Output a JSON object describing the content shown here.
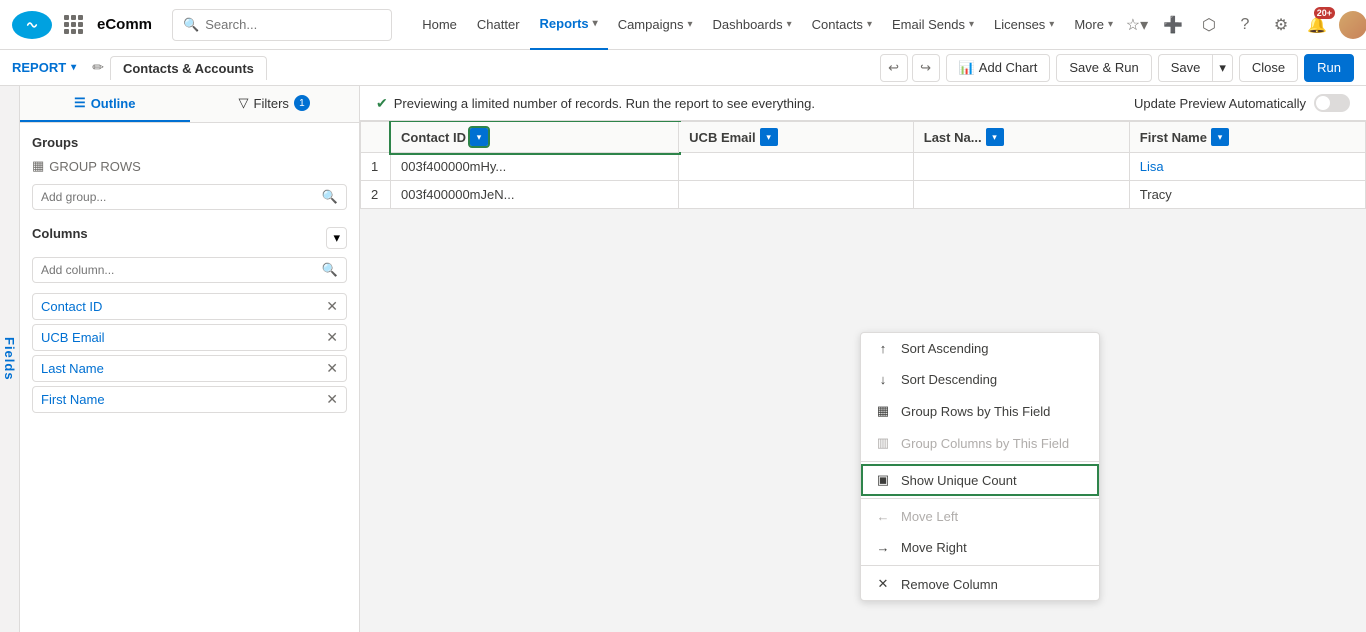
{
  "app": {
    "name": "eComm"
  },
  "topnav": {
    "search_placeholder": "Search...",
    "links": [
      {
        "label": "Home",
        "active": false,
        "has_dropdown": false
      },
      {
        "label": "Chatter",
        "active": false,
        "has_dropdown": false
      },
      {
        "label": "Reports",
        "active": true,
        "has_dropdown": true
      },
      {
        "label": "Campaigns",
        "active": false,
        "has_dropdown": true
      },
      {
        "label": "Dashboards",
        "active": false,
        "has_dropdown": true
      },
      {
        "label": "Contacts",
        "active": false,
        "has_dropdown": true
      },
      {
        "label": "Email Sends",
        "active": false,
        "has_dropdown": true
      },
      {
        "label": "Licenses",
        "active": false,
        "has_dropdown": true
      },
      {
        "label": "More",
        "active": false,
        "has_dropdown": true
      }
    ],
    "notification_count": "20+"
  },
  "secondarynav": {
    "report_badge_label": "REPORT",
    "report_name": "Contacts & Accounts",
    "toolbar": {
      "undo_title": "Undo",
      "redo_title": "Redo",
      "add_chart_label": "Add Chart",
      "save_run_label": "Save & Run",
      "save_label": "Save",
      "close_label": "Close",
      "run_label": "Run"
    }
  },
  "left_panel": {
    "outline_tab": "Outline",
    "filters_tab": "Filters",
    "filters_count": "1",
    "groups_label": "Groups",
    "group_rows_label": "GROUP ROWS",
    "add_group_placeholder": "Add group...",
    "columns_label": "Columns",
    "add_column_placeholder": "Add column...",
    "columns": [
      {
        "name": "Contact ID"
      },
      {
        "name": "UCB Email"
      },
      {
        "name": "Last Name"
      },
      {
        "name": "First Name"
      }
    ]
  },
  "preview": {
    "message": "Previewing a limited number of records. Run the report to see everything.",
    "update_label": "Update Preview Automatically",
    "toggle_on": false
  },
  "table": {
    "columns": [
      {
        "label": "Contact ID",
        "dropdown": true
      },
      {
        "label": "UCB Email",
        "dropdown": true
      },
      {
        "label": "Last Na...",
        "dropdown": true
      },
      {
        "label": "First Name",
        "dropdown": true
      }
    ],
    "rows": [
      {
        "num": "1",
        "contact_id": "003f400000mHy...",
        "ucb_email": "",
        "last_name": "",
        "first_name": "Lisa"
      },
      {
        "num": "2",
        "contact_id": "003f400000mJeN...",
        "ucb_email": "",
        "last_name": "",
        "first_name": "Tracy"
      }
    ]
  },
  "dropdown_menu": {
    "items": [
      {
        "id": "sort-asc",
        "label": "Sort Ascending",
        "icon": "sort-asc-icon",
        "disabled": false,
        "highlighted": false
      },
      {
        "id": "sort-desc",
        "label": "Sort Descending",
        "icon": "sort-desc-icon",
        "disabled": false,
        "highlighted": false
      },
      {
        "id": "group-rows",
        "label": "Group Rows by This Field",
        "icon": "group-rows-icon",
        "disabled": false,
        "highlighted": false
      },
      {
        "id": "group-cols",
        "label": "Group Columns by This Field",
        "icon": "group-cols-icon",
        "disabled": true,
        "highlighted": false
      },
      {
        "id": "show-unique",
        "label": "Show Unique Count",
        "icon": "count-icon",
        "disabled": false,
        "highlighted": true
      },
      {
        "id": "move-left",
        "label": "Move Left",
        "icon": "arrow-left-icon",
        "disabled": true,
        "highlighted": false
      },
      {
        "id": "move-right",
        "label": "Move Right",
        "icon": "arrow-right-icon",
        "disabled": false,
        "highlighted": false
      },
      {
        "id": "remove-col",
        "label": "Remove Column",
        "icon": "x-icon",
        "disabled": false,
        "highlighted": false
      }
    ]
  },
  "fields_sidebar": {
    "label": "Fields"
  }
}
